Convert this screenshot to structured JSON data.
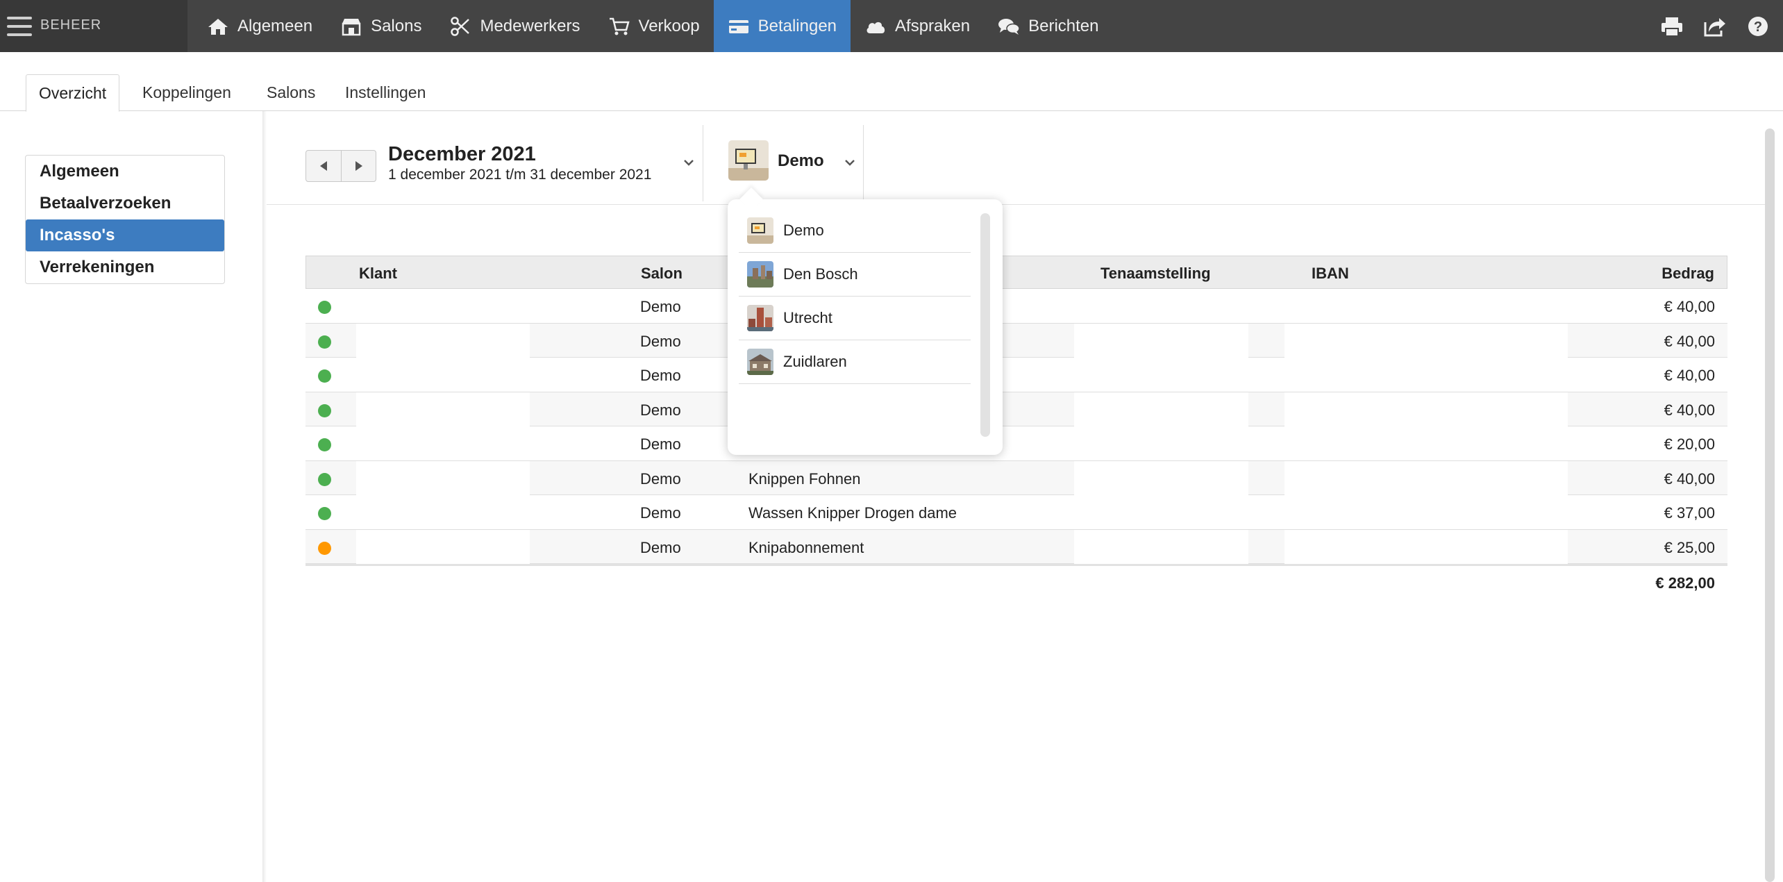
{
  "topbar": {
    "brand": "BEHEER",
    "nav": [
      {
        "label": "Algemeen",
        "icon": "home-icon"
      },
      {
        "label": "Salons",
        "icon": "storefront-icon"
      },
      {
        "label": "Medewerkers",
        "icon": "scissors-icon"
      },
      {
        "label": "Verkoop",
        "icon": "cart-icon"
      },
      {
        "label": "Betalingen",
        "icon": "credit-card-icon",
        "active": true
      },
      {
        "label": "Afspraken",
        "icon": "cloud-icon"
      },
      {
        "label": "Berichten",
        "icon": "chat-bubbles-icon"
      }
    ],
    "right_icons": [
      "print-icon",
      "share-icon",
      "help-icon"
    ]
  },
  "subtabs": [
    {
      "label": "Overzicht",
      "active": true
    },
    {
      "label": "Koppelingen"
    },
    {
      "label": "Salons"
    },
    {
      "label": "Instellingen"
    }
  ],
  "leftnav": [
    {
      "label": "Algemeen"
    },
    {
      "label": "Betaalverzoeken"
    },
    {
      "label": "Incasso's",
      "active": true
    },
    {
      "label": "Verrekeningen"
    }
  ],
  "period": {
    "title": "December 2021",
    "range": "1 december 2021 t/m 31 december 2021"
  },
  "salon_selector": {
    "selected": "Demo",
    "options": [
      "Demo",
      "Den Bosch",
      "Utrecht",
      "Zuidlaren"
    ]
  },
  "table": {
    "headers": {
      "klant": "Klant",
      "salon": "Salon",
      "tenaamstelling": "Tenaamstelling",
      "iban": "IBAN",
      "bedrag": "Bedrag"
    },
    "rows": [
      {
        "status": "green",
        "salon": "Demo",
        "omschrijving": "",
        "bedrag": "€ 40,00"
      },
      {
        "status": "green",
        "salon": "Demo",
        "omschrijving": "",
        "bedrag": "€ 40,00"
      },
      {
        "status": "green",
        "salon": "Demo",
        "omschrijving": "",
        "bedrag": "€ 40,00"
      },
      {
        "status": "green",
        "salon": "Demo",
        "omschrijving": "",
        "bedrag": "€ 40,00"
      },
      {
        "status": "green",
        "salon": "Demo",
        "omschrijving": "",
        "bedrag": "€ 20,00"
      },
      {
        "status": "green",
        "salon": "Demo",
        "omschrijving": "Knippen Fohnen",
        "bedrag": "€ 40,00"
      },
      {
        "status": "green",
        "salon": "Demo",
        "omschrijving": "Wassen Knipper Drogen dame",
        "bedrag": "€ 37,00"
      },
      {
        "status": "orange",
        "salon": "Demo",
        "omschrijving": "Knipabonnement",
        "bedrag": "€ 25,00"
      }
    ],
    "total": "€ 282,00"
  },
  "colors": {
    "accent": "#3d7cc0",
    "status_green": "#4caf50",
    "status_orange": "#ff9800",
    "topbar": "#444444"
  }
}
